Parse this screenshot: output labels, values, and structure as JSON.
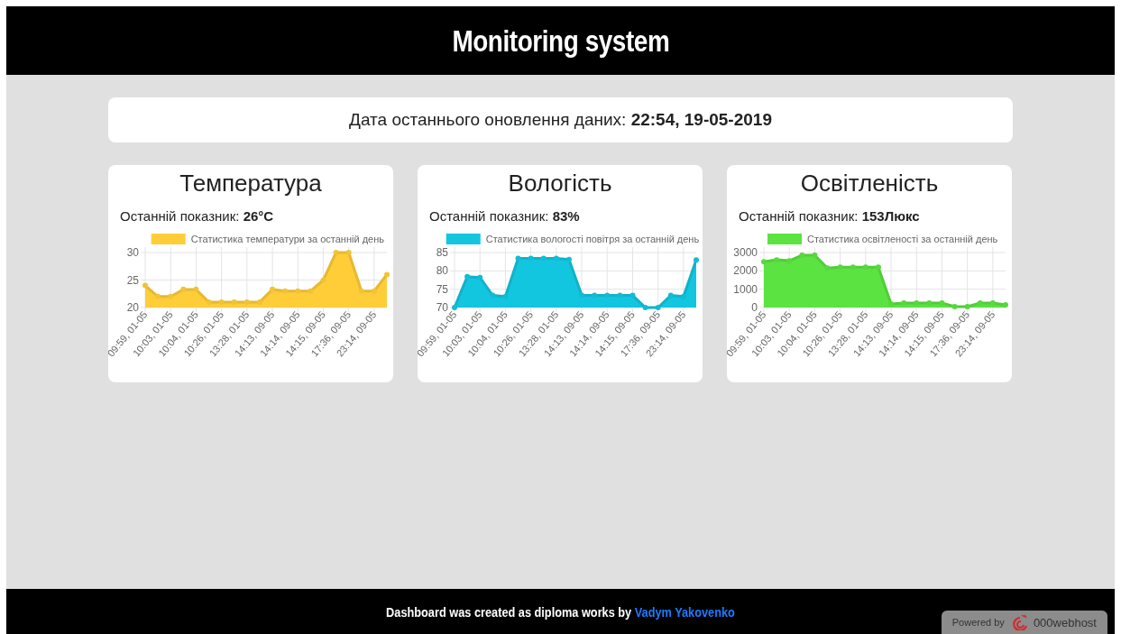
{
  "header": {
    "title": "Monitoring system"
  },
  "update": {
    "text": "Дата останнього оновлення даних: **22:54, 19-05-2019**"
  },
  "cards": [
    {
      "title": "Температура",
      "reading": "Останній показник: **26°C**",
      "chart_data": {
        "type": "area",
        "categories": [
          "09:59, 01-05",
          null,
          "10:03, 01-05",
          null,
          "10:04, 01-05",
          null,
          "10:26, 01-05",
          null,
          "13:28, 01-05",
          null,
          "14:13, 09-05",
          null,
          "14:14, 09-05",
          null,
          "14:15, 09-05",
          null,
          "17:36, 09-05",
          null,
          "23:14, 09-05",
          null
        ],
        "ylim": [
          20,
          30
        ],
        "grid": true,
        "yticks": [
          20,
          25,
          30
        ],
        "series": [
          {
            "name": "Статистика температури за останній день",
            "color": "#ffcd38",
            "values": [
              24,
              22,
              22,
              23.3,
              23.3,
              21,
              21,
              21,
              21,
              21,
              23.3,
              23,
              23,
              23,
              25,
              30,
              30,
              23,
              23,
              26
            ]
          }
        ]
      }
    },
    {
      "title": "Вологість",
      "reading": "Останній показник: **83%**",
      "chart_data": {
        "type": "area",
        "categories": [
          "09:59, 01-05",
          null,
          "10:03, 01-05",
          null,
          "10:04, 01-05",
          null,
          "10:26, 01-05",
          null,
          "13:28, 01-05",
          null,
          "14:13, 09-05",
          null,
          "14:14, 09-05",
          null,
          "14:15, 09-05",
          null,
          "17:36, 09-05",
          null,
          "23:14, 09-05",
          null
        ],
        "ylim": [
          70,
          85
        ],
        "grid": true,
        "yticks": [
          70,
          75,
          80,
          85
        ],
        "series": [
          {
            "name": "Статистика вологості повітря за останній день",
            "color": "#12c6e0",
            "values": [
              70,
              78.4,
              78.2,
              73.3,
              73,
              83.4,
              83.4,
              83.4,
              83.4,
              83.1,
              73.3,
              73.3,
              73.3,
              73.3,
              73.3,
              70,
              70,
              73.3,
              73,
              83
            ]
          }
        ]
      }
    },
    {
      "title": "Освітленість",
      "reading": "Останній показник: **153Люкс**",
      "chart_data": {
        "type": "area",
        "categories": [
          "09:59, 01-05",
          null,
          "10:03, 01-05",
          null,
          "10:04, 01-05",
          null,
          "10:26, 01-05",
          null,
          "13:28, 01-05",
          null,
          "14:13, 09-05",
          null,
          "14:14, 09-05",
          null,
          "14:15, 09-05",
          null,
          "17:36, 09-05",
          null,
          "23:14, 09-05",
          null
        ],
        "ylim": [
          0,
          3000
        ],
        "grid": true,
        "yticks": [
          0,
          1000,
          2000,
          3000
        ],
        "series": [
          {
            "name": "Статистика освітленості за останній день",
            "color": "#5be341",
            "values": [
              2500,
              2600,
              2550,
              2850,
              2850,
              2150,
              2200,
              2200,
              2200,
              2200,
              200,
              250,
              250,
              250,
              250,
              50,
              50,
              250,
              250,
              150
            ]
          }
        ]
      }
    }
  ],
  "footer": {
    "text": "Dashboard was created as diploma works by",
    "author": "Vadym Yakovenko",
    "badge": {
      "prefix": "Powered by",
      "brand": "000webhost"
    }
  }
}
